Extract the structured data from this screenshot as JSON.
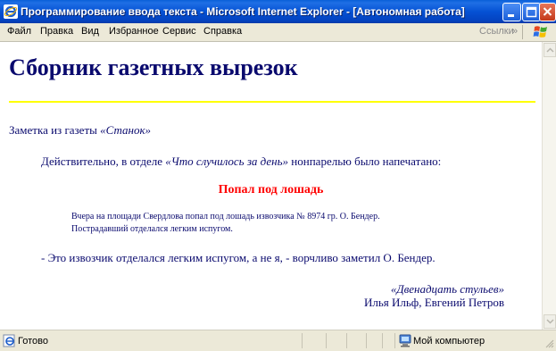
{
  "window": {
    "title": "Программирование ввода текста - Microsoft Internet Explorer - [Автономная работа]"
  },
  "menu": {
    "items": [
      "Файл",
      "Правка",
      "Вид",
      "Избранное",
      "Сервис",
      "Справка"
    ],
    "links_label": "Ссылки"
  },
  "page": {
    "heading": "Сборник газетных вырезок",
    "intro_prefix": "Заметка из газеты ",
    "intro_newspaper": "«Станок»",
    "para_before": "Действительно, в отделе ",
    "para_section": "«Что случилось за день»",
    "para_after": " нонпарелью было напечатано:",
    "headline": "Попал под лошадь",
    "note_line1": "Вчера на площади Свердлова попал под лошадь извозчика № 8974 гр. О. Бендер.",
    "note_line2": "Пострадавший отделался легким испугом.",
    "quote": "- Это извозчик отделался легким испугом, а не я, - ворчливо заметил О. Бендер.",
    "source_title": "«Двенадцать стульев»",
    "source_authors": "Илья Ильф, Евгений Петров"
  },
  "status": {
    "text": "Готово",
    "zone": "Мой компьютер"
  },
  "colors": {
    "text": "#0a0a6e",
    "headline": "#ff0000",
    "rule": "#ffff00",
    "titlebar": "#0551d4"
  }
}
